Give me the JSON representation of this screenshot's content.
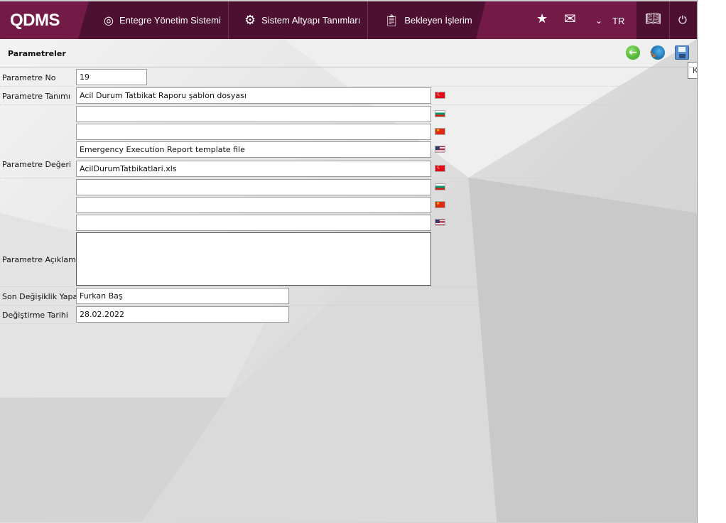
{
  "header": {
    "logo": "QDMS",
    "nav": [
      "Entegre Yönetim Sistemi",
      "Sistem Altyapı Tanımları",
      "Bekleyen İşlerim"
    ],
    "language": "TR"
  },
  "page": {
    "title": "Parametreler",
    "tooltip": "Kaydet"
  },
  "form": {
    "labels": {
      "no": "Parametre No",
      "tanim": "Parametre Tanımı",
      "deger": "Parametre Değeri",
      "aciklama": "Parametre Açıklaması",
      "son": "Son Değişiklik Yapan",
      "tarih": "Değiştirme Tarihi"
    },
    "no": "19",
    "tanim": {
      "tr": "Acil Durum Tatbikat Raporu şablon dosyası",
      "bg": "",
      "cn": "",
      "en": "Emergency Execution Report template file"
    },
    "deger": {
      "tr": "AcilDurumTatbikatlari.xls",
      "bg": "",
      "cn": "",
      "en": ""
    },
    "aciklama": "",
    "son": "Furkan Baş",
    "tarih": "28.02.2022"
  }
}
